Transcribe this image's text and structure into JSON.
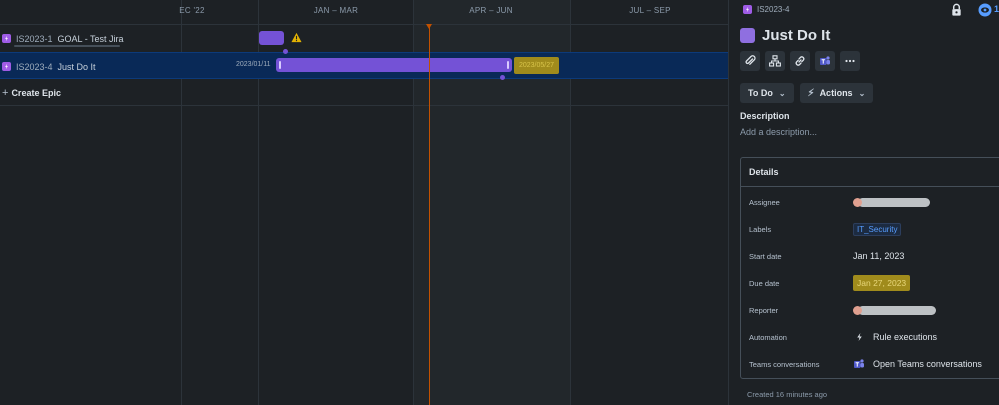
{
  "timeline": {
    "columns": [
      {
        "label": "EC '22"
      },
      {
        "label": "JAN – MAR"
      },
      {
        "label": "APR – JUN"
      },
      {
        "label": "JUL – SEP"
      }
    ],
    "rows": [
      {
        "key": "IS2023-1",
        "title": "GOAL - Test Jira"
      },
      {
        "key": "IS2023-4",
        "title": "Just Do It",
        "start_date": "2023/01/11",
        "due_date": "2023/05/27"
      }
    ],
    "create_epic_label": "Create Epic"
  },
  "panel": {
    "breadcrumb_key": "IS2023-4",
    "watch_count": "1",
    "title": "Just Do It",
    "status": "To Do",
    "actions_label": "Actions",
    "description_label": "Description",
    "description_placeholder": "Add a description...",
    "details_label": "Details",
    "fields": {
      "assignee_label": "Assignee",
      "labels_label": "Labels",
      "labels_value": "IT_Security",
      "start_date_label": "Start date",
      "start_date_value": "Jan 11, 2023",
      "due_date_label": "Due date",
      "due_date_value": "Jan 27, 2023",
      "reporter_label": "Reporter",
      "automation_label": "Automation",
      "automation_value": "Rule executions",
      "teams_label": "Teams conversations",
      "teams_value": "Open Teams conversations"
    },
    "created_text": "Created 16 minutes ago"
  },
  "colors": {
    "background": "#1d2125",
    "epic_purple": "#7452d6",
    "highlight_yellow": "#a08b1c",
    "selected_row": "#092957",
    "today_line": "#c25100",
    "link_blue": "#579dff"
  },
  "icons": [
    "epic-icon",
    "warning-icon",
    "lock-icon",
    "eye-icon",
    "attachment-icon",
    "child-issue-icon",
    "link-icon",
    "teams-icon",
    "more-icon",
    "chevron-down-icon",
    "lightning-icon"
  ]
}
